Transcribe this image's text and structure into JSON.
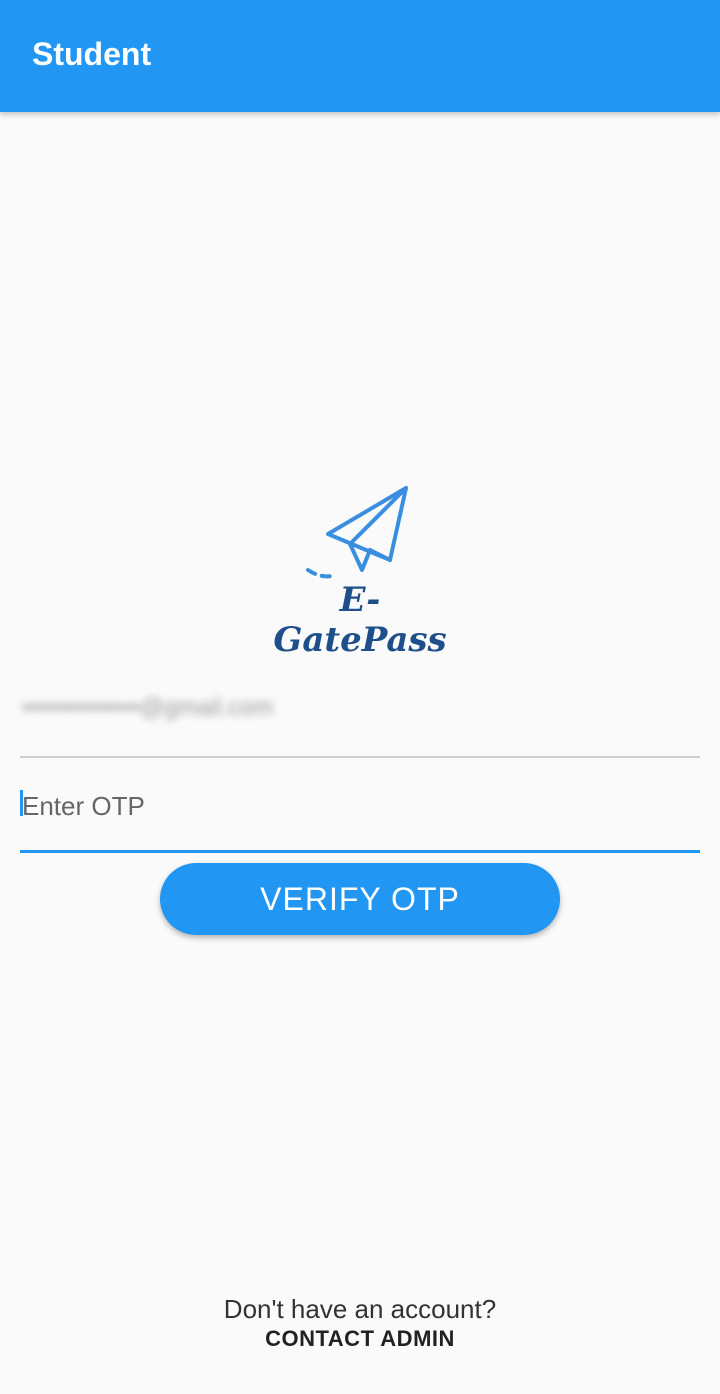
{
  "app_bar": {
    "title": "Student",
    "color": "#2196f3"
  },
  "logo": {
    "text": "E-GatePass",
    "icon": "paper-plane-icon",
    "color": "#3a8ee0"
  },
  "form": {
    "email_value": "••••••••••••••@gmail.com",
    "otp_placeholder": "Enter OTP",
    "verify_label": "VERIFY OTP"
  },
  "footer": {
    "question": "Don't have an account?",
    "link_label": "CONTACT ADMIN"
  }
}
